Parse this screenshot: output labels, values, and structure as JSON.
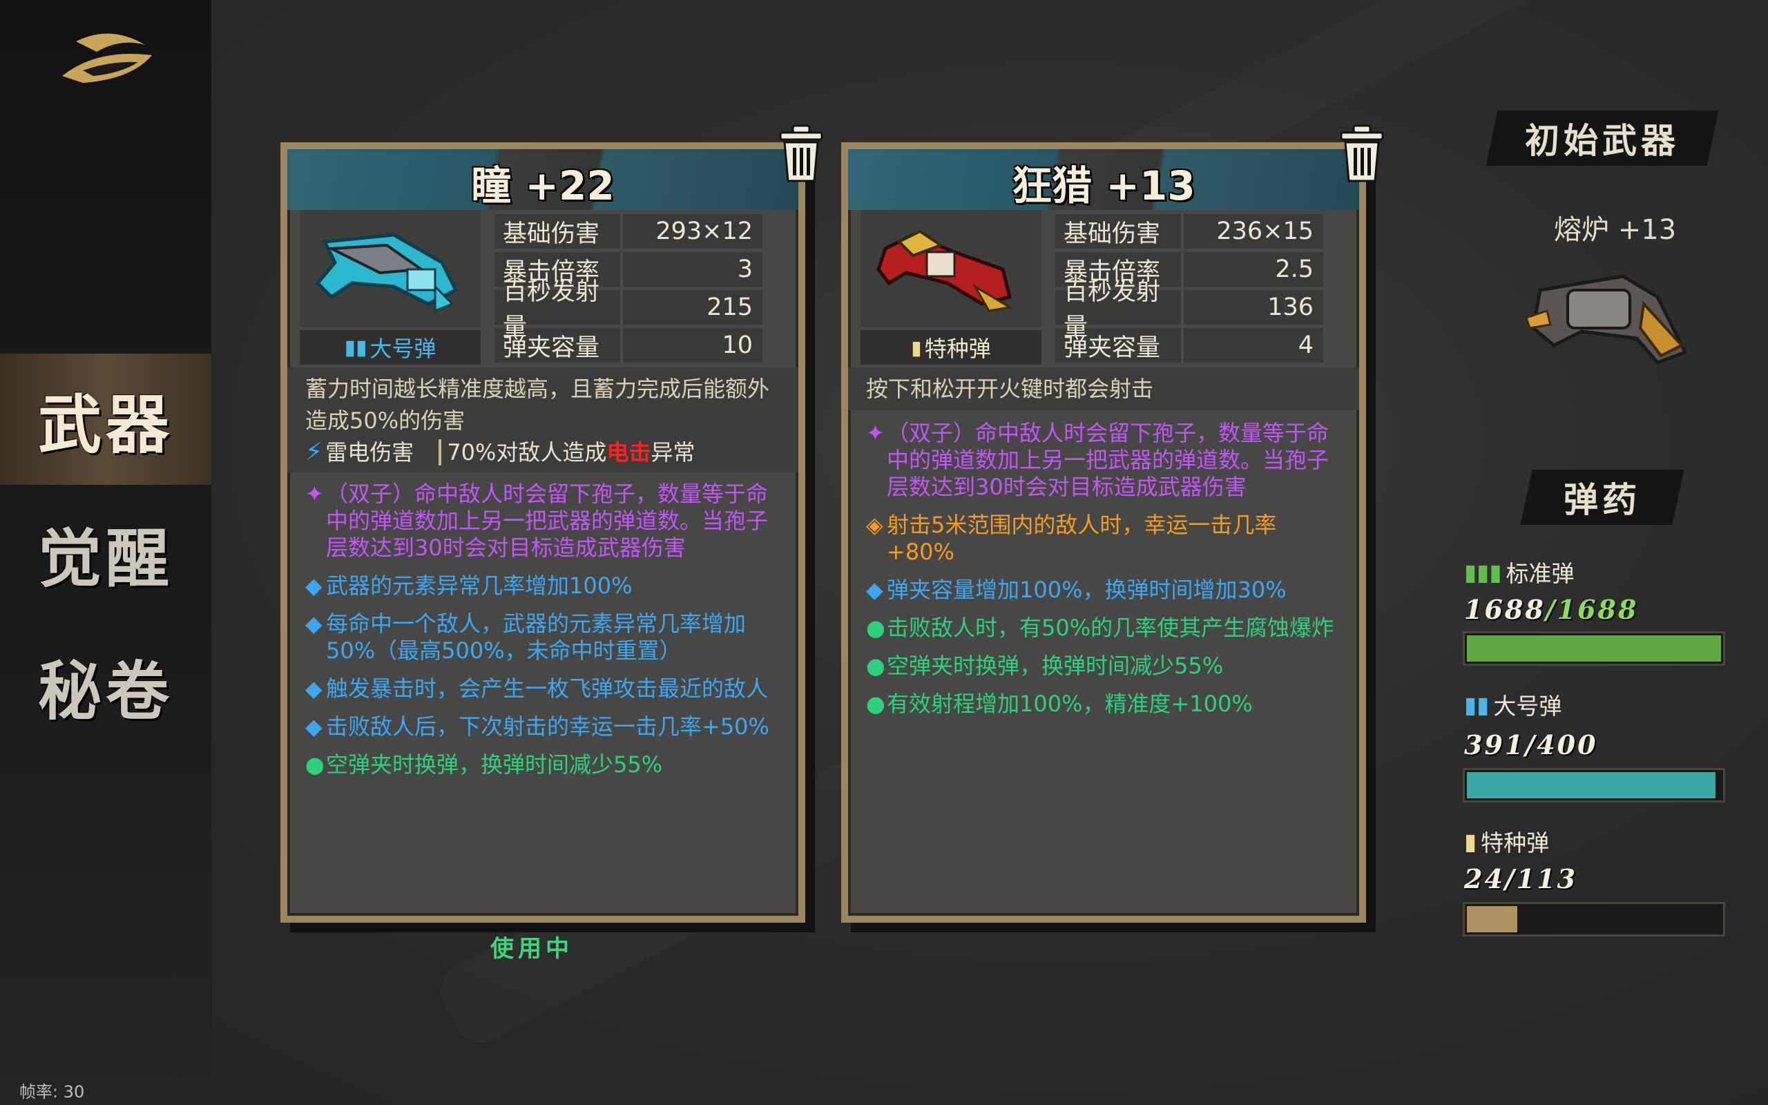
{
  "sidebar": {
    "items": [
      {
        "label": "武器",
        "active": true
      },
      {
        "label": "觉醒",
        "active": false
      },
      {
        "label": "秘卷",
        "active": false
      }
    ],
    "fps": "帧率: 30"
  },
  "weapons": [
    {
      "name": "瞳 +22",
      "ammo_type": "大号弹",
      "ammo_icon": "large-ammo-icon",
      "stats": [
        {
          "label": "基础伤害",
          "value": "293×12"
        },
        {
          "label": "暴击倍率",
          "value": "3"
        },
        {
          "label": "百秒发射量",
          "value": "215"
        },
        {
          "label": "弹夹容量",
          "value": "10"
        }
      ],
      "description": "蓄力时间越长精准度越高，且蓄力完成后能额外造成50%的伤害",
      "element": {
        "name": "雷电伤害",
        "text_prefix": "70%对敌人造成",
        "highlight": "电击",
        "text_suffix": "异常"
      },
      "perks": [
        {
          "marker": "✦",
          "color": "purple",
          "text": "（双子）命中敌人时会留下孢子，数量等于命中的弹道数加上另一把武器的弹道数。当孢子层数达到30时会对目标造成武器伤害"
        },
        {
          "marker": "◆",
          "color": "blue",
          "text": "武器的元素异常几率增加100%"
        },
        {
          "marker": "◆",
          "color": "blue",
          "text": "每命中一个敌人，武器的元素异常几率增加50%（最高500%，未命中时重置）"
        },
        {
          "marker": "◆",
          "color": "blue",
          "text": "触发暴击时，会产生一枚飞弹攻击最近的敌人"
        },
        {
          "marker": "◆",
          "color": "blue",
          "text": "击败敌人后，下次射击的幸运一击几率+50%"
        },
        {
          "marker": "●",
          "color": "green",
          "text": "空弹夹时换弹，换弹时间减少55%"
        }
      ],
      "status": "使用中"
    },
    {
      "name": "狂猎 +13",
      "ammo_type": "特种弹",
      "ammo_icon": "special-ammo-icon",
      "stats": [
        {
          "label": "基础伤害",
          "value": "236×15"
        },
        {
          "label": "暴击倍率",
          "value": "2.5"
        },
        {
          "label": "百秒发射量",
          "value": "136"
        },
        {
          "label": "弹夹容量",
          "value": "4"
        }
      ],
      "description": "按下和松开开火键时都会射击",
      "perks": [
        {
          "marker": "✦",
          "color": "purple",
          "text": "（双子）命中敌人时会留下孢子，数量等于命中的弹道数加上另一把武器的弹道数。当孢子层数达到30时会对目标造成武器伤害"
        },
        {
          "marker": "◈",
          "color": "orange",
          "text": "射击5米范围内的敌人时，幸运一击几率+80%"
        },
        {
          "marker": "◆",
          "color": "blue",
          "text": "弹夹容量增加100%，换弹时间增加30%"
        },
        {
          "marker": "●",
          "color": "green",
          "text": "击败敌人时，有50%的几率使其产生腐蚀爆炸"
        },
        {
          "marker": "●",
          "color": "green",
          "text": "空弹夹时换弹，换弹时间减少55%"
        },
        {
          "marker": "●",
          "color": "green",
          "text": "有效射程增加100%，精准度+100%"
        }
      ]
    }
  ],
  "starter": {
    "title": "初始武器",
    "weapon_name": "熔炉  +13"
  },
  "ammo": {
    "title": "弹药",
    "types": [
      {
        "label": "标准弹",
        "current": "1688",
        "max": "1688",
        "fraction": 1.0,
        "color": "#5fa844",
        "max_color": "#8ddc5a"
      },
      {
        "label": "大号弹",
        "current": "391",
        "max": "400",
        "fraction": 0.978,
        "color": "#3aa7a7",
        "max_color": "#f6f0e0"
      },
      {
        "label": "特种弹",
        "current": "24",
        "max": "113",
        "fraction": 0.212,
        "color": "#b09360",
        "max_color": "#f6f0e0"
      }
    ]
  },
  "colors": {
    "purple": "#c255f5",
    "blue": "#3ea6f1",
    "green": "#2fd07c",
    "orange": "#f59a22"
  }
}
